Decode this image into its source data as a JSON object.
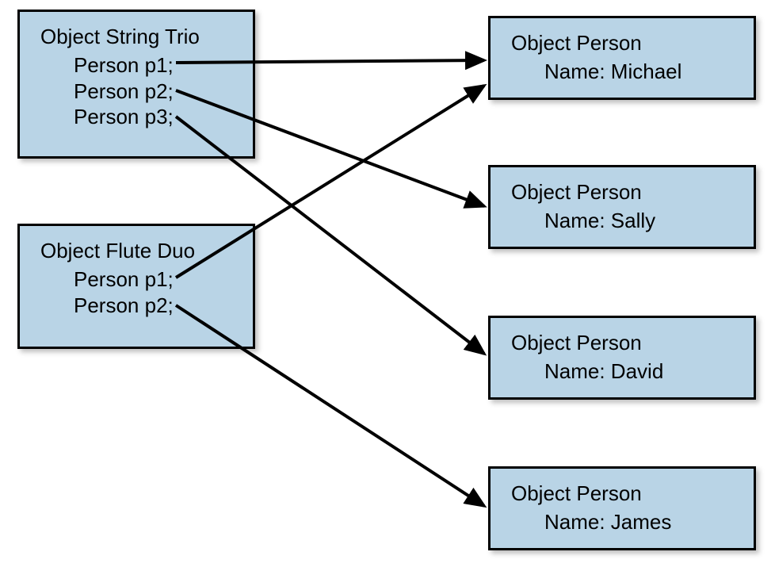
{
  "leftBoxes": {
    "stringTrio": {
      "title": "Object String Trio",
      "members": [
        "Person p1;",
        "Person p2;",
        "Person p3;"
      ]
    },
    "fluteDuo": {
      "title": "Object Flute Duo",
      "members": [
        "Person p1;",
        "Person p2;"
      ]
    }
  },
  "rightBoxes": {
    "michael": {
      "title": "Object Person",
      "name": "Name: Michael"
    },
    "sally": {
      "title": "Object Person",
      "name": "Name: Sally"
    },
    "david": {
      "title": "Object Person",
      "name": "Name: David"
    },
    "james": {
      "title": "Object Person",
      "name": "Name: James"
    }
  },
  "arrows": [
    {
      "from": "stringTrio.p1",
      "to": "michael"
    },
    {
      "from": "stringTrio.p2",
      "to": "sally"
    },
    {
      "from": "stringTrio.p3",
      "to": "david"
    },
    {
      "from": "fluteDuo.p1",
      "to": "michael"
    },
    {
      "from": "fluteDuo.p2",
      "to": "james"
    }
  ]
}
